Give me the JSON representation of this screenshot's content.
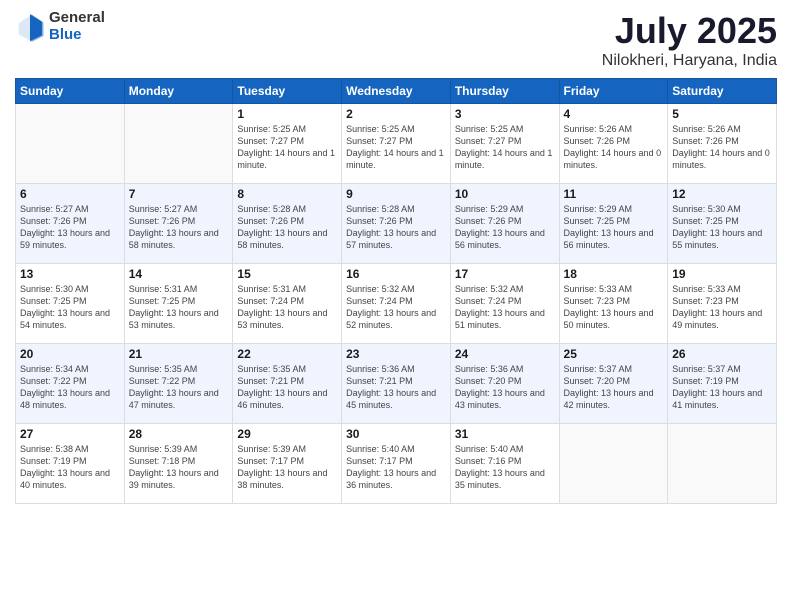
{
  "header": {
    "logo_general": "General",
    "logo_blue": "Blue",
    "month": "July 2025",
    "location": "Nilokheri, Haryana, India"
  },
  "weekdays": [
    "Sunday",
    "Monday",
    "Tuesday",
    "Wednesday",
    "Thursday",
    "Friday",
    "Saturday"
  ],
  "weeks": [
    [
      {
        "day": "",
        "info": ""
      },
      {
        "day": "",
        "info": ""
      },
      {
        "day": "1",
        "info": "Sunrise: 5:25 AM\nSunset: 7:27 PM\nDaylight: 14 hours and 1 minute."
      },
      {
        "day": "2",
        "info": "Sunrise: 5:25 AM\nSunset: 7:27 PM\nDaylight: 14 hours and 1 minute."
      },
      {
        "day": "3",
        "info": "Sunrise: 5:25 AM\nSunset: 7:27 PM\nDaylight: 14 hours and 1 minute."
      },
      {
        "day": "4",
        "info": "Sunrise: 5:26 AM\nSunset: 7:26 PM\nDaylight: 14 hours and 0 minutes."
      },
      {
        "day": "5",
        "info": "Sunrise: 5:26 AM\nSunset: 7:26 PM\nDaylight: 14 hours and 0 minutes."
      }
    ],
    [
      {
        "day": "6",
        "info": "Sunrise: 5:27 AM\nSunset: 7:26 PM\nDaylight: 13 hours and 59 minutes."
      },
      {
        "day": "7",
        "info": "Sunrise: 5:27 AM\nSunset: 7:26 PM\nDaylight: 13 hours and 58 minutes."
      },
      {
        "day": "8",
        "info": "Sunrise: 5:28 AM\nSunset: 7:26 PM\nDaylight: 13 hours and 58 minutes."
      },
      {
        "day": "9",
        "info": "Sunrise: 5:28 AM\nSunset: 7:26 PM\nDaylight: 13 hours and 57 minutes."
      },
      {
        "day": "10",
        "info": "Sunrise: 5:29 AM\nSunset: 7:26 PM\nDaylight: 13 hours and 56 minutes."
      },
      {
        "day": "11",
        "info": "Sunrise: 5:29 AM\nSunset: 7:25 PM\nDaylight: 13 hours and 56 minutes."
      },
      {
        "day": "12",
        "info": "Sunrise: 5:30 AM\nSunset: 7:25 PM\nDaylight: 13 hours and 55 minutes."
      }
    ],
    [
      {
        "day": "13",
        "info": "Sunrise: 5:30 AM\nSunset: 7:25 PM\nDaylight: 13 hours and 54 minutes."
      },
      {
        "day": "14",
        "info": "Sunrise: 5:31 AM\nSunset: 7:25 PM\nDaylight: 13 hours and 53 minutes."
      },
      {
        "day": "15",
        "info": "Sunrise: 5:31 AM\nSunset: 7:24 PM\nDaylight: 13 hours and 53 minutes."
      },
      {
        "day": "16",
        "info": "Sunrise: 5:32 AM\nSunset: 7:24 PM\nDaylight: 13 hours and 52 minutes."
      },
      {
        "day": "17",
        "info": "Sunrise: 5:32 AM\nSunset: 7:24 PM\nDaylight: 13 hours and 51 minutes."
      },
      {
        "day": "18",
        "info": "Sunrise: 5:33 AM\nSunset: 7:23 PM\nDaylight: 13 hours and 50 minutes."
      },
      {
        "day": "19",
        "info": "Sunrise: 5:33 AM\nSunset: 7:23 PM\nDaylight: 13 hours and 49 minutes."
      }
    ],
    [
      {
        "day": "20",
        "info": "Sunrise: 5:34 AM\nSunset: 7:22 PM\nDaylight: 13 hours and 48 minutes."
      },
      {
        "day": "21",
        "info": "Sunrise: 5:35 AM\nSunset: 7:22 PM\nDaylight: 13 hours and 47 minutes."
      },
      {
        "day": "22",
        "info": "Sunrise: 5:35 AM\nSunset: 7:21 PM\nDaylight: 13 hours and 46 minutes."
      },
      {
        "day": "23",
        "info": "Sunrise: 5:36 AM\nSunset: 7:21 PM\nDaylight: 13 hours and 45 minutes."
      },
      {
        "day": "24",
        "info": "Sunrise: 5:36 AM\nSunset: 7:20 PM\nDaylight: 13 hours and 43 minutes."
      },
      {
        "day": "25",
        "info": "Sunrise: 5:37 AM\nSunset: 7:20 PM\nDaylight: 13 hours and 42 minutes."
      },
      {
        "day": "26",
        "info": "Sunrise: 5:37 AM\nSunset: 7:19 PM\nDaylight: 13 hours and 41 minutes."
      }
    ],
    [
      {
        "day": "27",
        "info": "Sunrise: 5:38 AM\nSunset: 7:19 PM\nDaylight: 13 hours and 40 minutes."
      },
      {
        "day": "28",
        "info": "Sunrise: 5:39 AM\nSunset: 7:18 PM\nDaylight: 13 hours and 39 minutes."
      },
      {
        "day": "29",
        "info": "Sunrise: 5:39 AM\nSunset: 7:17 PM\nDaylight: 13 hours and 38 minutes."
      },
      {
        "day": "30",
        "info": "Sunrise: 5:40 AM\nSunset: 7:17 PM\nDaylight: 13 hours and 36 minutes."
      },
      {
        "day": "31",
        "info": "Sunrise: 5:40 AM\nSunset: 7:16 PM\nDaylight: 13 hours and 35 minutes."
      },
      {
        "day": "",
        "info": ""
      },
      {
        "day": "",
        "info": ""
      }
    ]
  ]
}
